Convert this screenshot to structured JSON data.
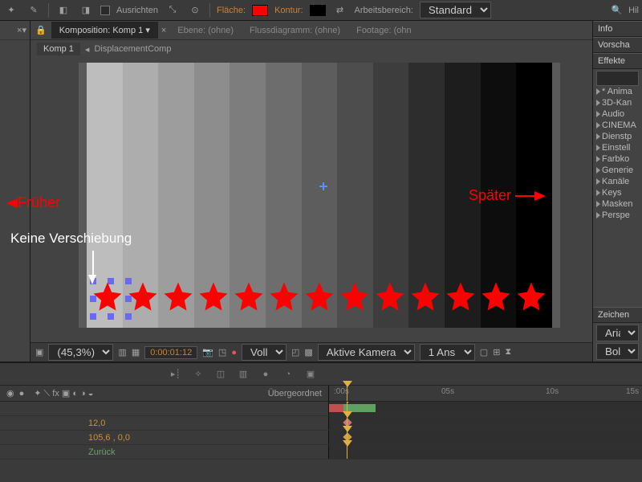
{
  "topbar": {
    "align_label": "Ausrichten",
    "fill_label": "Fläche:",
    "stroke_label": "Kontur:",
    "workspace_label": "Arbeitsbereich:",
    "workspace_value": "Standard",
    "help_label": "Hil",
    "fill_color": "#ff0000",
    "stroke_color": "#000000"
  },
  "tabs": {
    "composition": "Komposition: Komp 1",
    "layer": "Ebene: (ohne)",
    "flowchart": "Flussdiagramm: (ohne)",
    "footage": "Footage: (ohn"
  },
  "crumb": {
    "a": "Komp 1",
    "b": "DisplacementComp"
  },
  "annotations": {
    "earlier": "Früher",
    "later": "Später",
    "noshift": "Keine Verschiebung"
  },
  "status": {
    "zoom": "(45,3%)",
    "timecode": "0:00:01:12",
    "resolution": "Voll",
    "camera": "Aktive Kamera",
    "views": "1 Ans"
  },
  "rightpanels": {
    "info": "Info",
    "preview": "Vorscha",
    "effects": "Effekte",
    "character": "Zeichen",
    "font": "Arial",
    "weight": "Bold",
    "search_placeholder": "",
    "effects_list": [
      "* Anima",
      "3D-Kan",
      "Audio",
      "CINEMA",
      "Dienstp",
      "Einstell",
      "Farbko",
      "Generie",
      "Kanäle",
      "Keys",
      "Masken",
      "Perspe"
    ]
  },
  "timeline": {
    "parent_col": "Übergeordnet",
    "ruler": {
      "t0": ":00s",
      "t1": "05s",
      "t2": "10s",
      "t3": "15s"
    },
    "rows": {
      "r1_label": "",
      "r2_label": "12,0",
      "r3_label": "105,6 , 0,0",
      "r4_label": "Zurück"
    }
  }
}
